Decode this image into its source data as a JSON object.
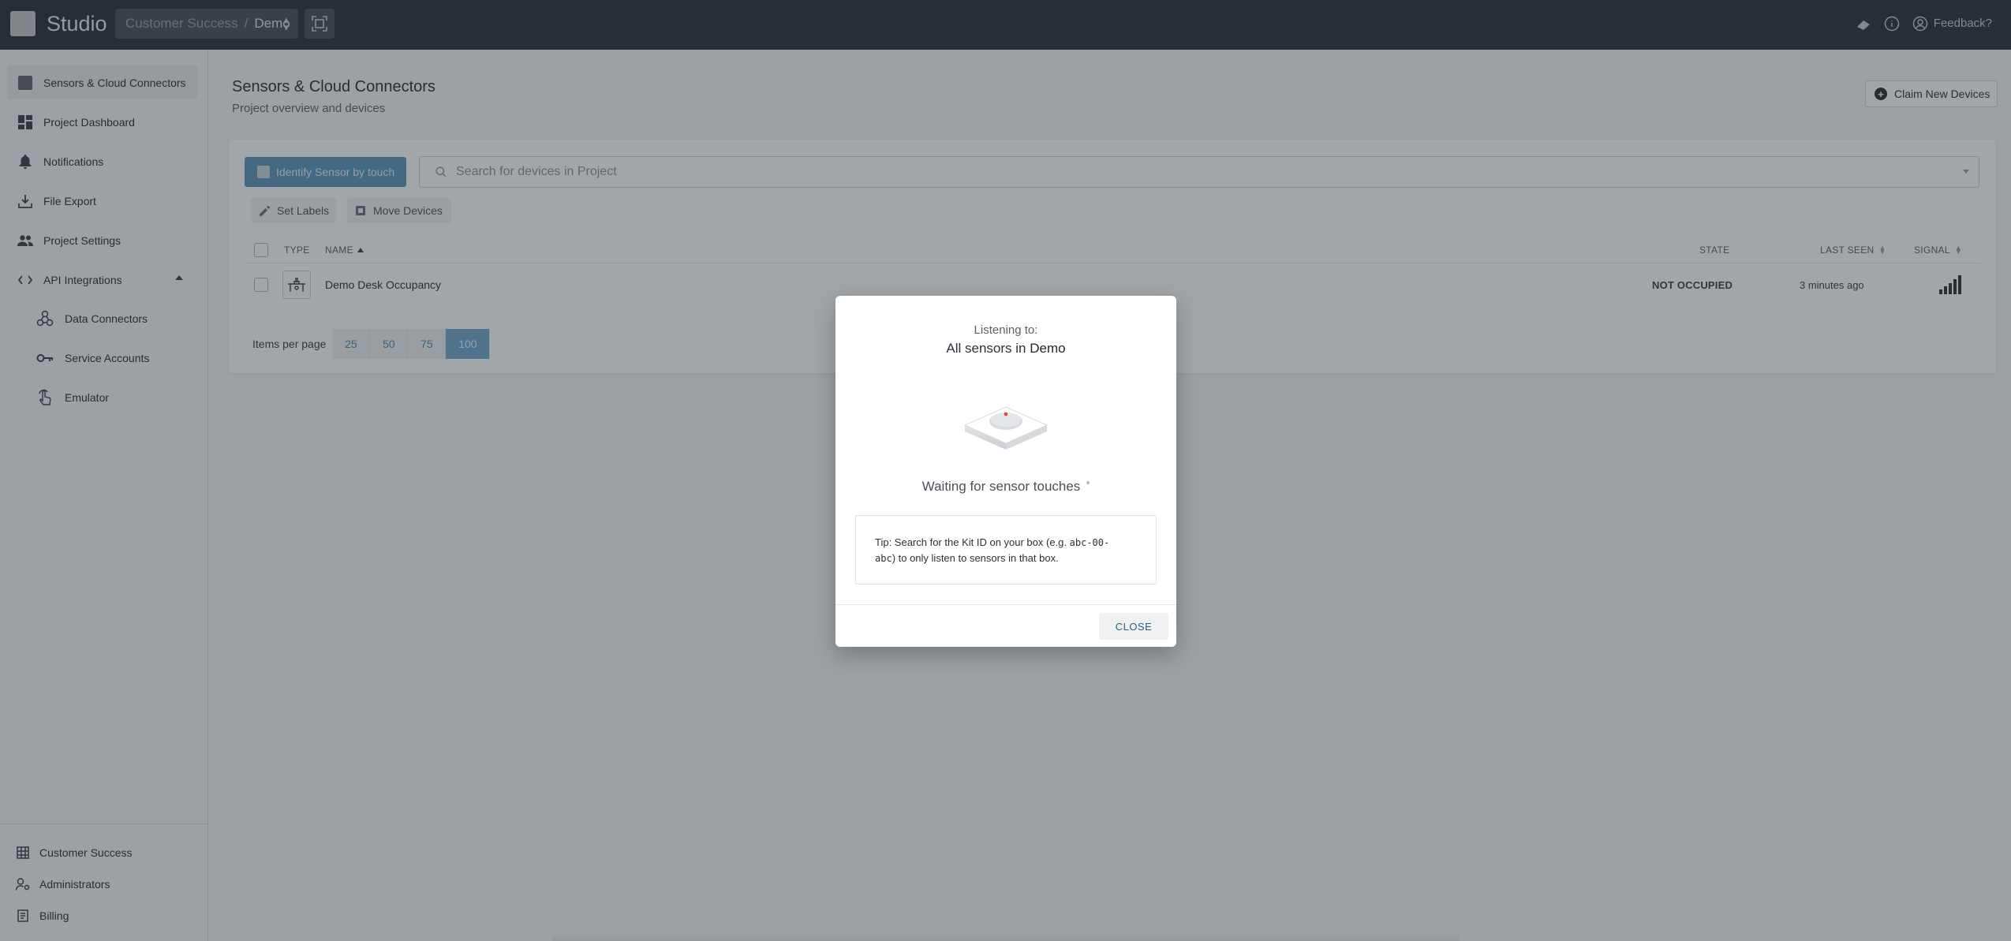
{
  "topbar": {
    "app_title": "Studio",
    "org": "Customer Success",
    "separator": "/",
    "project": "Demo",
    "feedback": "Feedback?"
  },
  "sidebar": {
    "items": [
      {
        "label": "Sensors & Cloud Connectors",
        "icon": "sensor-square-icon",
        "active": true
      },
      {
        "label": "Project Dashboard",
        "icon": "dashboard-icon"
      },
      {
        "label": "Notifications",
        "icon": "bell-icon"
      },
      {
        "label": "File Export",
        "icon": "download-icon"
      },
      {
        "label": "Project Settings",
        "icon": "people-icon"
      },
      {
        "label": "API Integrations",
        "icon": "code-icon",
        "expanded": true
      }
    ],
    "sub_items": [
      {
        "label": "Data Connectors",
        "icon": "connectors-icon"
      },
      {
        "label": "Service Accounts",
        "icon": "key-icon"
      },
      {
        "label": "Emulator",
        "icon": "touch-icon"
      }
    ],
    "footer": [
      {
        "label": "Customer Success",
        "icon": "building-icon"
      },
      {
        "label": "Administrators",
        "icon": "admin-icon"
      },
      {
        "label": "Billing",
        "icon": "billing-icon"
      }
    ]
  },
  "main": {
    "title": "Sensors & Cloud Connectors",
    "subtitle": "Project overview and devices",
    "claim_button": "Claim New Devices",
    "identify_button": "Identify Sensor by touch",
    "search_placeholder": "Search for devices in Project",
    "set_labels": "Set Labels",
    "move_devices": "Move Devices",
    "table": {
      "columns": {
        "type": "TYPE",
        "name": "NAME",
        "state": "STATE",
        "last_seen": "LAST SEEN",
        "signal": "SIGNAL"
      },
      "rows": [
        {
          "name": "Demo Desk Occupancy",
          "state": "NOT OCCUPIED",
          "last_seen": "3 minutes ago",
          "signal_bars": 5
        }
      ]
    },
    "pager": {
      "label": "Items per page",
      "options": [
        "25",
        "50",
        "75",
        "100"
      ],
      "selected": "100"
    }
  },
  "modal": {
    "listening_label": "Listening to:",
    "target_prefix": "All sensors in",
    "target_project": "Demo",
    "waiting": "Waiting for sensor touches",
    "tip_1": "Tip: Search for the Kit ID on your box (e.g. ",
    "tip_code_a": "abc-00-",
    "tip_code_b": "abc",
    "tip_2": ") to only listen to sensors in that box.",
    "close": "CLOSE"
  },
  "colors": {
    "topbar": "#2b3138",
    "accent": "#5c96be",
    "sensor_dot": "#e0463c"
  }
}
